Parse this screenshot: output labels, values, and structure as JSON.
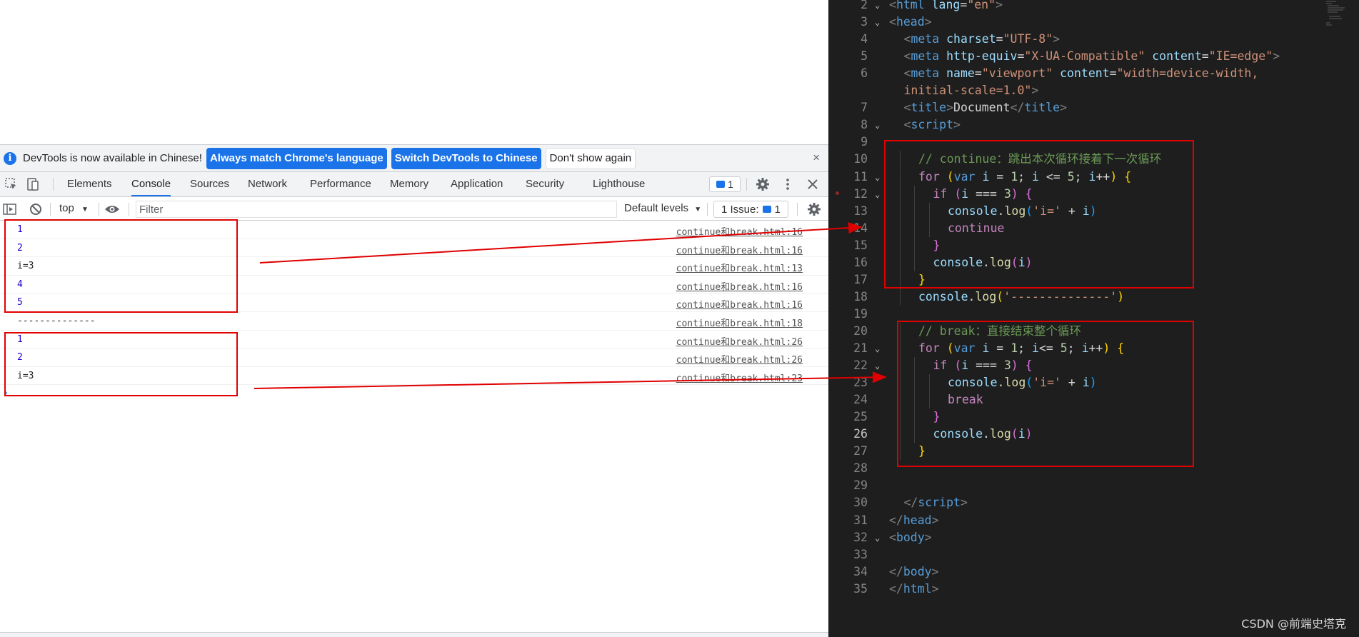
{
  "devtools": {
    "infobar": {
      "message": "DevTools is now available in Chinese!",
      "btn_match": "Always match Chrome's language",
      "btn_switch": "Switch DevTools to Chinese",
      "btn_dont_show": "Don't show again",
      "close": "×"
    },
    "tabs": [
      "Elements",
      "Console",
      "Sources",
      "Network",
      "Performance",
      "Memory",
      "Application",
      "Security",
      "Lighthouse"
    ],
    "active_tab": "Console",
    "issues_count": "1",
    "toolbar": {
      "context": "top",
      "filter_placeholder": "Filter",
      "levels": "Default levels",
      "issues_label": "1 Issue:",
      "issues_num": "1"
    },
    "console_rows": [
      {
        "value": "1",
        "source": "continue和break.html:16",
        "kind": "num"
      },
      {
        "value": "2",
        "source": "continue和break.html:16",
        "kind": "num"
      },
      {
        "value": "i=3",
        "source": "continue和break.html:13",
        "kind": "str"
      },
      {
        "value": "4",
        "source": "continue和break.html:16",
        "kind": "num"
      },
      {
        "value": "5",
        "source": "continue和break.html:16",
        "kind": "num"
      },
      {
        "value": "--------------",
        "source": "continue和break.html:18",
        "kind": "str"
      },
      {
        "value": "1",
        "source": "continue和break.html:26",
        "kind": "num"
      },
      {
        "value": "2",
        "source": "continue和break.html:26",
        "kind": "num"
      },
      {
        "value": "i=3",
        "source": "continue和break.html:23",
        "kind": "str"
      }
    ]
  },
  "editor": {
    "current_line": 26,
    "lines": [
      {
        "n": "2",
        "indent": 0,
        "fold": true,
        "tokens": [
          [
            "t-punct",
            "<"
          ],
          [
            "t-tag",
            "html"
          ],
          [
            "t-text",
            " "
          ],
          [
            "t-attr",
            "lang"
          ],
          [
            "t-text",
            "="
          ],
          [
            "t-str",
            "\"en\""
          ],
          [
            "t-punct",
            ">"
          ]
        ]
      },
      {
        "n": "3",
        "indent": 0,
        "fold": true,
        "tokens": [
          [
            "t-punct",
            "<"
          ],
          [
            "t-tag",
            "head"
          ],
          [
            "t-punct",
            ">"
          ]
        ]
      },
      {
        "n": "4",
        "indent": 1,
        "fold": false,
        "tokens": [
          [
            "t-punct",
            "<"
          ],
          [
            "t-tag",
            "meta"
          ],
          [
            "t-text",
            " "
          ],
          [
            "t-attr",
            "charset"
          ],
          [
            "t-text",
            "="
          ],
          [
            "t-str",
            "\"UTF-8\""
          ],
          [
            "t-punct",
            ">"
          ]
        ]
      },
      {
        "n": "5",
        "indent": 1,
        "fold": false,
        "tokens": [
          [
            "t-punct",
            "<"
          ],
          [
            "t-tag",
            "meta"
          ],
          [
            "t-text",
            " "
          ],
          [
            "t-attr",
            "http-equiv"
          ],
          [
            "t-text",
            "="
          ],
          [
            "t-str",
            "\"X-UA-Compatible\""
          ],
          [
            "t-text",
            " "
          ],
          [
            "t-attr",
            "content"
          ],
          [
            "t-text",
            "="
          ],
          [
            "t-str",
            "\"IE=edge\""
          ],
          [
            "t-punct",
            ">"
          ]
        ]
      },
      {
        "n": "6",
        "indent": 1,
        "fold": false,
        "tokens": [
          [
            "t-punct",
            "<"
          ],
          [
            "t-tag",
            "meta"
          ],
          [
            "t-text",
            " "
          ],
          [
            "t-attr",
            "name"
          ],
          [
            "t-text",
            "="
          ],
          [
            "t-str",
            "\"viewport\""
          ],
          [
            "t-text",
            " "
          ],
          [
            "t-attr",
            "content"
          ],
          [
            "t-text",
            "="
          ],
          [
            "t-str",
            "\"width=device-width,"
          ]
        ]
      },
      {
        "n": "",
        "indent": 1,
        "fold": false,
        "tokens": [
          [
            "t-str",
            "initial-scale=1.0\""
          ],
          [
            "t-punct",
            ">"
          ]
        ]
      },
      {
        "n": "7",
        "indent": 1,
        "fold": false,
        "tokens": [
          [
            "t-punct",
            "<"
          ],
          [
            "t-tag",
            "title"
          ],
          [
            "t-punct",
            ">"
          ],
          [
            "t-text",
            "Document"
          ],
          [
            "t-punct",
            "</"
          ],
          [
            "t-tag",
            "title"
          ],
          [
            "t-punct",
            ">"
          ]
        ]
      },
      {
        "n": "8",
        "indent": 1,
        "fold": true,
        "tokens": [
          [
            "t-punct",
            "<"
          ],
          [
            "t-tag",
            "script"
          ],
          [
            "t-punct",
            ">"
          ]
        ]
      },
      {
        "n": "9",
        "indent": 0,
        "fold": false,
        "tokens": []
      },
      {
        "n": "10",
        "indent": 2,
        "fold": false,
        "tokens": [
          [
            "t-cmt",
            "// continue：跳出本次循环接着下一次循环"
          ]
        ]
      },
      {
        "n": "11",
        "indent": 2,
        "fold": true,
        "tokens": [
          [
            "t-ctrl",
            "for"
          ],
          [
            "t-text",
            " "
          ],
          [
            "b-y",
            "("
          ],
          [
            "t-kw",
            "var"
          ],
          [
            "t-text",
            " "
          ],
          [
            "t-var",
            "i"
          ],
          [
            "t-text",
            " = "
          ],
          [
            "t-num",
            "1"
          ],
          [
            "t-text",
            "; "
          ],
          [
            "t-var",
            "i"
          ],
          [
            "t-text",
            " <= "
          ],
          [
            "t-num",
            "5"
          ],
          [
            "t-text",
            "; "
          ],
          [
            "t-var",
            "i"
          ],
          [
            "t-text",
            "++"
          ],
          [
            "b-y",
            ")"
          ],
          [
            "t-text",
            " "
          ],
          [
            "b-y",
            "{"
          ]
        ]
      },
      {
        "n": "12",
        "indent": 3,
        "fold": true,
        "tokens": [
          [
            "t-ctrl",
            "if"
          ],
          [
            "t-text",
            " "
          ],
          [
            "b-p",
            "("
          ],
          [
            "t-var",
            "i"
          ],
          [
            "t-text",
            " === "
          ],
          [
            "t-num",
            "3"
          ],
          [
            "b-p",
            ")"
          ],
          [
            "t-text",
            " "
          ],
          [
            "b-p",
            "{"
          ]
        ]
      },
      {
        "n": "13",
        "indent": 4,
        "fold": false,
        "tokens": [
          [
            "t-var",
            "console"
          ],
          [
            "t-text",
            "."
          ],
          [
            "t-fn",
            "log"
          ],
          [
            "b-b",
            "("
          ],
          [
            "t-str",
            "'i='"
          ],
          [
            "t-text",
            " + "
          ],
          [
            "t-var",
            "i"
          ],
          [
            "b-b",
            ")"
          ]
        ]
      },
      {
        "n": "14",
        "indent": 4,
        "fold": false,
        "tokens": [
          [
            "t-ctrl",
            "continue"
          ]
        ]
      },
      {
        "n": "15",
        "indent": 3,
        "fold": false,
        "tokens": [
          [
            "b-p",
            "}"
          ]
        ]
      },
      {
        "n": "16",
        "indent": 3,
        "fold": false,
        "tokens": [
          [
            "t-var",
            "console"
          ],
          [
            "t-text",
            "."
          ],
          [
            "t-fn",
            "log"
          ],
          [
            "b-p",
            "("
          ],
          [
            "t-var",
            "i"
          ],
          [
            "b-p",
            ")"
          ]
        ]
      },
      {
        "n": "17",
        "indent": 2,
        "fold": false,
        "tokens": [
          [
            "b-y",
            "}"
          ]
        ]
      },
      {
        "n": "18",
        "indent": 2,
        "fold": false,
        "tokens": [
          [
            "t-var",
            "console"
          ],
          [
            "t-text",
            "."
          ],
          [
            "t-fn",
            "log"
          ],
          [
            "b-y",
            "("
          ],
          [
            "t-str",
            "'--------------'"
          ],
          [
            "b-y",
            ")"
          ]
        ]
      },
      {
        "n": "19",
        "indent": 0,
        "fold": false,
        "tokens": []
      },
      {
        "n": "20",
        "indent": 2,
        "fold": false,
        "tokens": [
          [
            "t-cmt",
            "// break：直接结束整个循环"
          ]
        ]
      },
      {
        "n": "21",
        "indent": 2,
        "fold": true,
        "tokens": [
          [
            "t-ctrl",
            "for"
          ],
          [
            "t-text",
            " "
          ],
          [
            "b-y",
            "("
          ],
          [
            "t-kw",
            "var"
          ],
          [
            "t-text",
            " "
          ],
          [
            "t-var",
            "i"
          ],
          [
            "t-text",
            " = "
          ],
          [
            "t-num",
            "1"
          ],
          [
            "t-text",
            "; "
          ],
          [
            "t-var",
            "i"
          ],
          [
            "t-text",
            "<= "
          ],
          [
            "t-num",
            "5"
          ],
          [
            "t-text",
            "; "
          ],
          [
            "t-var",
            "i"
          ],
          [
            "t-text",
            "++"
          ],
          [
            "b-y",
            ")"
          ],
          [
            "t-text",
            " "
          ],
          [
            "b-y",
            "{"
          ]
        ]
      },
      {
        "n": "22",
        "indent": 3,
        "fold": true,
        "tokens": [
          [
            "t-ctrl",
            "if"
          ],
          [
            "t-text",
            " "
          ],
          [
            "b-p",
            "("
          ],
          [
            "t-var",
            "i"
          ],
          [
            "t-text",
            " === "
          ],
          [
            "t-num",
            "3"
          ],
          [
            "b-p",
            ")"
          ],
          [
            "t-text",
            " "
          ],
          [
            "b-p",
            "{"
          ]
        ]
      },
      {
        "n": "23",
        "indent": 4,
        "fold": false,
        "tokens": [
          [
            "t-var",
            "console"
          ],
          [
            "t-text",
            "."
          ],
          [
            "t-fn",
            "log"
          ],
          [
            "b-b",
            "("
          ],
          [
            "t-str",
            "'i='"
          ],
          [
            "t-text",
            " + "
          ],
          [
            "t-var",
            "i"
          ],
          [
            "b-b",
            ")"
          ]
        ]
      },
      {
        "n": "24",
        "indent": 4,
        "fold": false,
        "tokens": [
          [
            "t-ctrl",
            "break"
          ]
        ]
      },
      {
        "n": "25",
        "indent": 3,
        "fold": false,
        "tokens": [
          [
            "b-p",
            "}"
          ]
        ]
      },
      {
        "n": "26",
        "indent": 3,
        "fold": false,
        "tokens": [
          [
            "t-var",
            "console"
          ],
          [
            "t-text",
            "."
          ],
          [
            "t-fn",
            "log"
          ],
          [
            "b-p",
            "("
          ],
          [
            "t-var",
            "i"
          ],
          [
            "b-p",
            ")"
          ]
        ]
      },
      {
        "n": "27",
        "indent": 2,
        "fold": false,
        "tokens": [
          [
            "b-y",
            "}"
          ]
        ]
      },
      {
        "n": "28",
        "indent": 0,
        "fold": false,
        "tokens": []
      },
      {
        "n": "29",
        "indent": 0,
        "fold": false,
        "tokens": []
      },
      {
        "n": "30",
        "indent": 1,
        "fold": false,
        "tokens": [
          [
            "t-punct",
            "</"
          ],
          [
            "t-tag",
            "script"
          ],
          [
            "t-punct",
            ">"
          ]
        ]
      },
      {
        "n": "31",
        "indent": 0,
        "fold": false,
        "tokens": [
          [
            "t-punct",
            "</"
          ],
          [
            "t-tag",
            "head"
          ],
          [
            "t-punct",
            ">"
          ]
        ]
      },
      {
        "n": "32",
        "indent": 0,
        "fold": true,
        "tokens": [
          [
            "t-punct",
            "<"
          ],
          [
            "t-tag",
            "body"
          ],
          [
            "t-punct",
            ">"
          ]
        ]
      },
      {
        "n": "33",
        "indent": 0,
        "fold": false,
        "tokens": []
      },
      {
        "n": "34",
        "indent": 0,
        "fold": false,
        "tokens": [
          [
            "t-punct",
            "</"
          ],
          [
            "t-tag",
            "body"
          ],
          [
            "t-punct",
            ">"
          ]
        ]
      },
      {
        "n": "35",
        "indent": 0,
        "fold": false,
        "tokens": [
          [
            "t-punct",
            "</"
          ],
          [
            "t-tag",
            "html"
          ],
          [
            "t-punct",
            ">"
          ]
        ]
      }
    ]
  },
  "watermark": "CSDN @前端史塔克",
  "colors": {
    "annotation_red": "#e00000",
    "devtools_blue": "#1a73e8",
    "editor_bg": "#1e1e1e"
  }
}
